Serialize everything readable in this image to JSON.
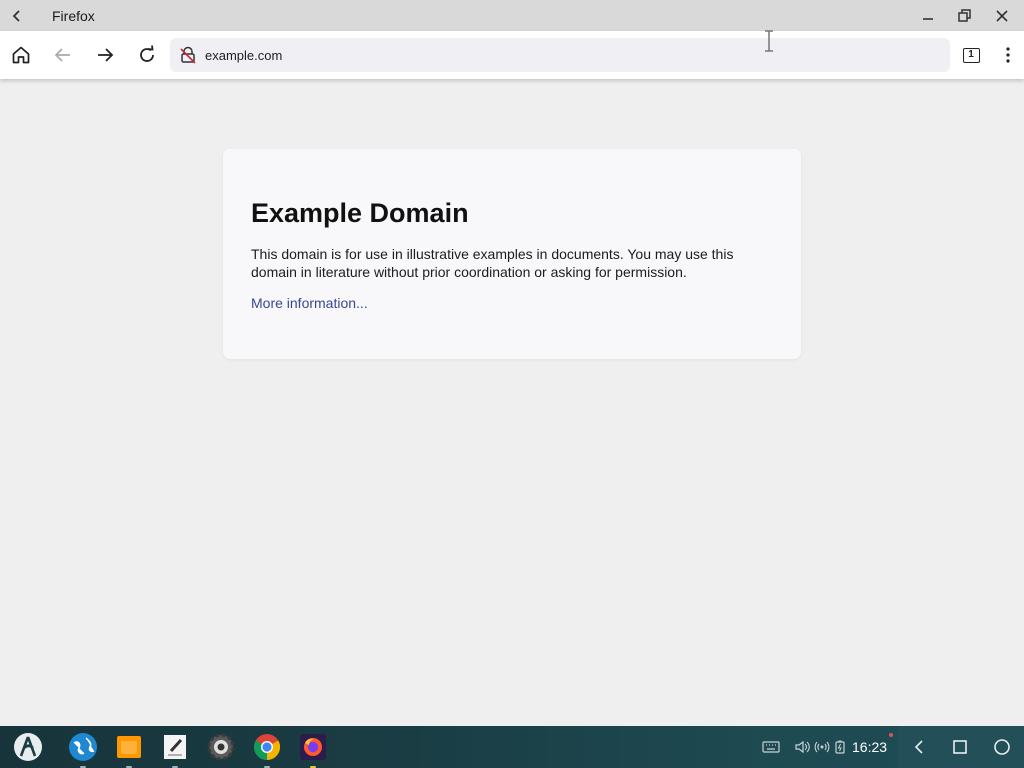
{
  "window": {
    "title": "Firefox"
  },
  "navbar": {
    "url": "example.com",
    "tab_count": "1"
  },
  "page": {
    "heading": "Example Domain",
    "body": "This domain is for use in illustrative examples in documents. You may use this domain in literature without prior coordination or asking for permission.",
    "link": "More information..."
  },
  "taskbar": {
    "apps": [
      "launcher-icon",
      "browser-globe-icon",
      "files-icon",
      "text-editor-icon",
      "settings-icon",
      "chrome-icon",
      "firefox-icon"
    ],
    "clock": "16:23"
  },
  "colors": {
    "titlebar": "#d9d9d9",
    "page_bg": "#efefef",
    "card_bg": "#f8f8fa",
    "link": "#38488f",
    "taskbar": "#1a3d44"
  }
}
